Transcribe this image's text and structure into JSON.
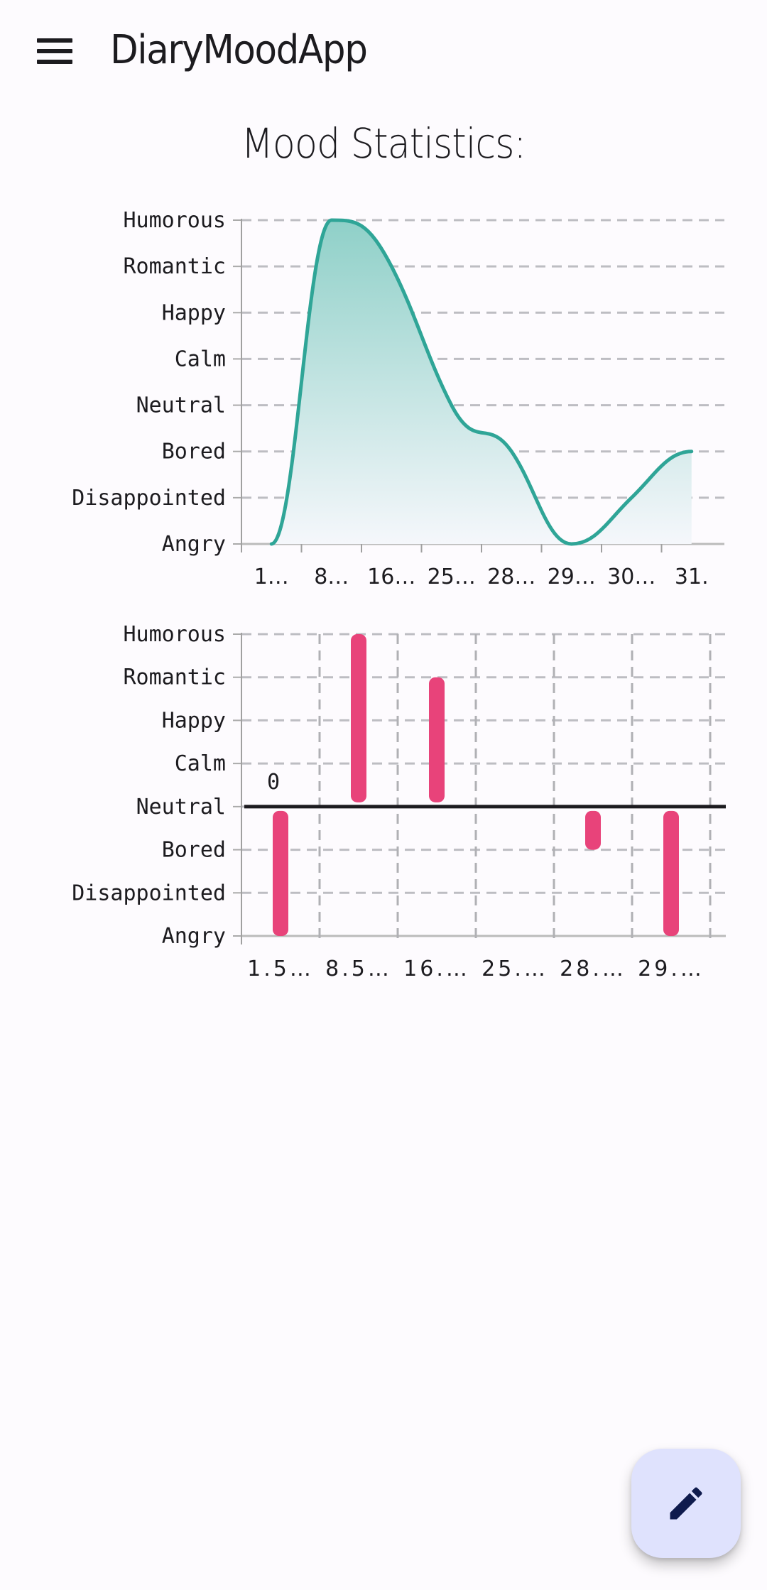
{
  "app": {
    "title": "DiaryMoodApp",
    "menu_icon": "hamburger-menu-icon"
  },
  "page": {
    "title": "Mood Statistics:"
  },
  "fab": {
    "icon": "pencil-edit-icon",
    "color": "#dfe2fd",
    "icon_color": "#0f1b4d"
  },
  "chart_data": [
    {
      "type": "area",
      "title": "",
      "xlabel": "",
      "ylabel": "",
      "y_categories": [
        "Angry",
        "Disappointed",
        "Bored",
        "Neutral",
        "Calm",
        "Happy",
        "Romantic",
        "Humorous"
      ],
      "categories": [
        "1…",
        "8…",
        "16…",
        "25…",
        "28…",
        "29…",
        "30…",
        "31."
      ],
      "values": [
        0,
        7,
        6,
        3,
        2,
        0,
        1,
        2
      ],
      "value_labels": [
        "Angry",
        "Humorous",
        "Romantic",
        "Neutral",
        "Bored",
        "Angry",
        "Disappointed",
        "Bored"
      ],
      "ylim": [
        0,
        7
      ],
      "grid": "horizontal-dashed",
      "curve": "smooth",
      "line_color": "#2fa597",
      "fill_gradient": [
        "#8fd0c8",
        "#f5f7fb"
      ]
    },
    {
      "type": "bar",
      "title": "",
      "xlabel": "",
      "ylabel": "",
      "y_categories": [
        "Angry",
        "Disappointed",
        "Bored",
        "Neutral",
        "Calm",
        "Happy",
        "Romantic",
        "Humorous"
      ],
      "categories": [
        "1.5…",
        "8.5…",
        "16.…",
        "25.…",
        "28.…",
        "29.…"
      ],
      "values": [
        0,
        7,
        6,
        3,
        2,
        0
      ],
      "value_labels": [
        "Angry",
        "Humorous",
        "Romantic",
        "Neutral",
        "Bored",
        "Angry"
      ],
      "baseline": 3,
      "baseline_label": "Neutral",
      "annotation": "0",
      "ylim": [
        0,
        7
      ],
      "grid": "both-dashed",
      "bar_color": "#e8437a"
    }
  ]
}
